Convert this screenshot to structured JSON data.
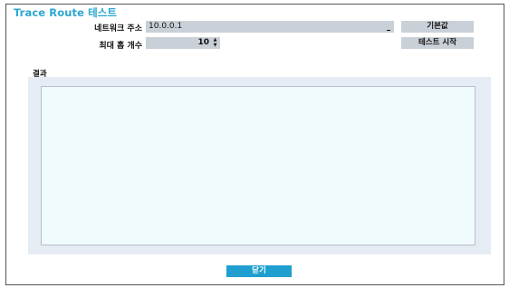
{
  "dialog": {
    "title": "Trace Route 테스트"
  },
  "form": {
    "network_address_label": "네트워크 주소",
    "network_address_value": "10.0.0.1",
    "max_hops_label": "최대 홉 개수",
    "max_hops_value": "10",
    "spinner_up_icon": "triangle-up",
    "spinner_down_icon": "triangle-down"
  },
  "buttons": {
    "default_label": "기본값",
    "start_test_label": "테스트 시작",
    "close_label": "닫기"
  },
  "result": {
    "label": "결과",
    "content": ""
  },
  "colors": {
    "title": "#2aa7cf",
    "input_bg": "#c9d0d8",
    "button_bg": "#c9d0d8",
    "close_button_bg": "#1f9fcf",
    "result_panel_bg": "#e6ecf3",
    "result_box_bg": "#f0fbfd"
  }
}
